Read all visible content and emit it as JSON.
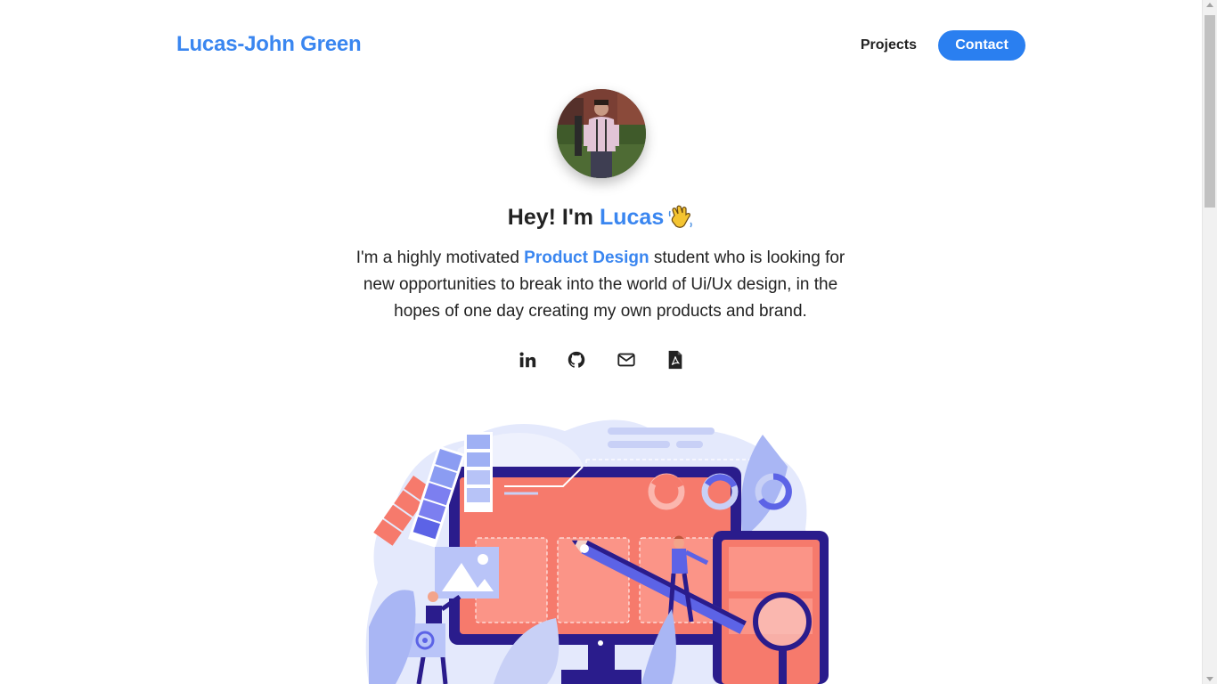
{
  "header": {
    "brand": "Lucas-John Green",
    "nav": {
      "projects_label": "Projects",
      "contact_label": "Contact"
    }
  },
  "hero": {
    "greeting_prefix": "Hey! I'm ",
    "greeting_name": "Lucas",
    "wave_icon": "waving-hand-icon",
    "intro_prefix": "I'm a highly motivated ",
    "intro_highlight": "Product Design",
    "intro_suffix": " student who is looking for new opportunities to break into the world of Ui/Ux design, in the hopes of one day creating my own products and brand.",
    "avatar_alt": "Profile photo of Lucas"
  },
  "socials": [
    {
      "icon": "linkedin-icon"
    },
    {
      "icon": "github-icon"
    },
    {
      "icon": "email-icon"
    },
    {
      "icon": "pdf-resume-icon"
    }
  ],
  "colors": {
    "accent": "#3a86f0",
    "button": "#2a7ff0",
    "illustration_coral": "#f67a6c",
    "illustration_navy": "#2a1c8c",
    "illustration_periwinkle": "#8b9cf2"
  }
}
